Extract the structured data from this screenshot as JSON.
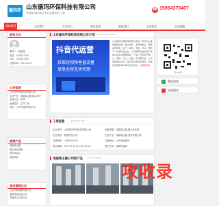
{
  "header": {
    "logo_text": "循玛环保",
    "title": "山东循玛环保科技有限公司",
    "subtitle": "电磁除尘器,烟尘净化,除雾系统,工程",
    "phone": "15954370407"
  },
  "nav": {
    "items": [
      "网站首页",
      "公司简介",
      "产品中心",
      "供应信息",
      "联系我们",
      "企业资讯",
      "企业相册"
    ]
  },
  "contact": {
    "title": "联系方式",
    "avatar_label": "",
    "rows": [
      "联系人：胡经理",
      "电话：15954370407",
      "手机：15954370407",
      "注册时间：2021-06-10"
    ]
  },
  "company_info": {
    "title": "公司信息",
    "rows": [
      "山东循玛环保科技有限公司",
      "主营产品：电磁除尘器,烟尘净化",
      "主营行业：环保",
      "经营模式：生产厂家",
      "地址：山东省淄博市淄川区"
    ]
  },
  "products_nav": {
    "title": "推荐产品",
    "items": [
      "电磁除尘器",
      "烟尘净化设备",
      "湿式电除尘",
      "除雾系统"
    ]
  },
  "related_companies": {
    "title": "相关推荐企业",
    "items": [
      "山东环保设备有限公司",
      "淄博净化科技公司",
      "济南除尘工程公司"
    ]
  },
  "intro_card": {
    "title": "山东循玛环保科技有限公司介绍",
    "en": "Company Introduction",
    "promo_title": "抖音代运营",
    "promo_line1": "获取短视频垂直流量",
    "promo_line2": "享受全程无忧代理",
    "text": "山东循玛环保科技有限公司是一家专业从事电磁除尘器、烟尘净化、湿式电除尘、除雾系统研发、生产、销售、安装、调试、服务于一体的综合企业。公司拥有先进的生产设备与完善的质量体系，产品广泛应用于电力、钢铁、化工、冶金、建材等行业。公司秉承诚信为本、客户至上的经营理念，真诚欢迎新老客户来电洽谈合作。",
    "more": "[查看详情]"
  },
  "business_card": {
    "title": "工商信息",
    "en": "Business Info",
    "left": [
      "企业名称：山东循玛环保科技有限公司",
      "企业类型：有限责任公司",
      "注册资本：人民币1000万",
      "营业期限：2019-01-30 至 2021-01-30"
    ],
    "right": [
      "经营范围：电磁除尘器,烟尘净化等",
      "主营产品：电磁除尘器,湿式电除尘等",
      "注册地址：山东省淄博市",
      "登记机关：淄博市监局"
    ]
  },
  "products_card": {
    "title": "电磁除尘器公司新产品",
    "en": "New Products"
  },
  "right": {
    "qr_label": "扫一扫",
    "btn1": "微信咨询",
    "btn2": "在线留言"
  },
  "watermark": "攻收录",
  "colors": {
    "accent": "#e33333",
    "promo_blue": "#2a63e6",
    "phone": "#e23333"
  }
}
